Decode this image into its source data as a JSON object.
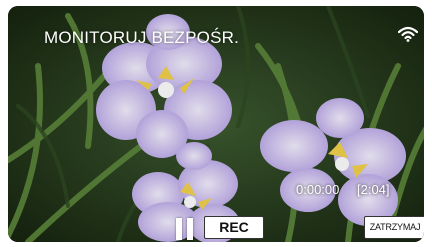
{
  "header": {
    "title": "MONITORUJ BEZPOŚR.",
    "wifi_icon": "wifi-icon"
  },
  "status": {
    "elapsed_time": "0:00:00",
    "remaining_time": "[2:04]"
  },
  "controls": {
    "pause_icon": "pause-icon",
    "rec_label": "REC",
    "stop_label": "ZATRZYMAJ"
  },
  "colors": {
    "text": "#ffffff",
    "button_bg": "#ffffff",
    "button_text": "#111111"
  }
}
